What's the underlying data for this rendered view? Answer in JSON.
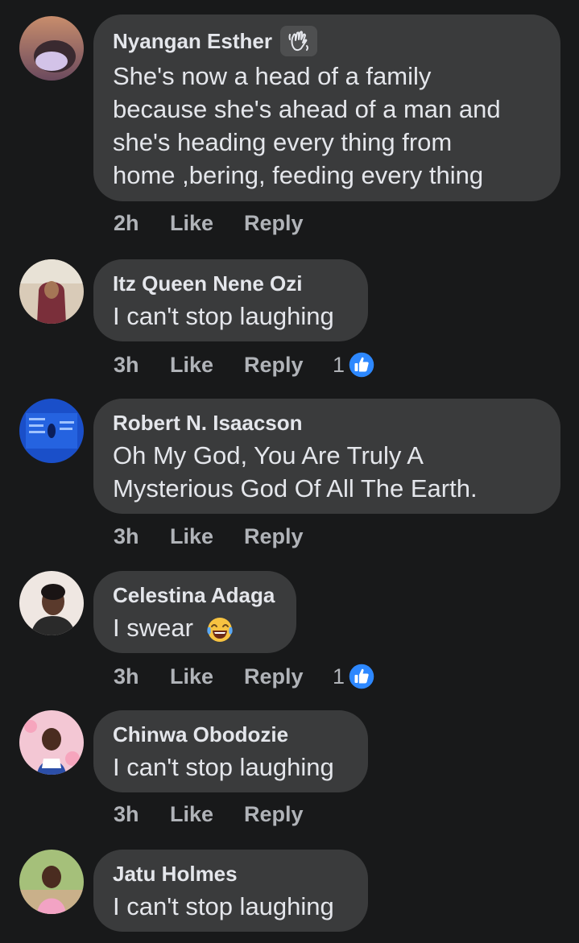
{
  "colors": {
    "background": "#18191a",
    "bubble": "#3a3b3c",
    "name_text": "#e4e6eb",
    "body_text": "#e4e6eb",
    "meta_text": "#b0b3b8",
    "like_blue": "#2d88ff"
  },
  "comments": [
    {
      "author": "Nyangan Esther",
      "badge_icon": "waving-hand-icon",
      "lines": [
        "She's now a head of a family",
        "because she's ahead of a man and",
        "she's heading every thing from",
        "home ,bering, feeding every thing"
      ],
      "time": "2h",
      "like_label": "Like",
      "reply_label": "Reply"
    },
    {
      "author": "Itz Queen Nene Ozi",
      "lines": [
        "I can't stop laughing"
      ],
      "time": "3h",
      "like_label": "Like",
      "reply_label": "Reply",
      "reaction_count": "1",
      "reaction_icon": "thumbs-up-icon"
    },
    {
      "author": "Robert N. Isaacson",
      "lines": [
        "Oh My God, You Are Truly A",
        "Mysterious God Of All The Earth."
      ],
      "time": "3h",
      "like_label": "Like",
      "reply_label": "Reply"
    },
    {
      "author": "Celestina Adaga",
      "lines": [
        "I swear"
      ],
      "emoji_icon": "tears-of-joy-emoji-icon",
      "time": "3h",
      "like_label": "Like",
      "reply_label": "Reply",
      "reaction_count": "1",
      "reaction_icon": "thumbs-up-icon"
    },
    {
      "author": "Chinwa Obodozie",
      "lines": [
        "I can't stop laughing"
      ],
      "time": "3h",
      "like_label": "Like",
      "reply_label": "Reply"
    },
    {
      "author": "Jatu Holmes",
      "lines": [
        "I can't stop laughing"
      ]
    }
  ]
}
